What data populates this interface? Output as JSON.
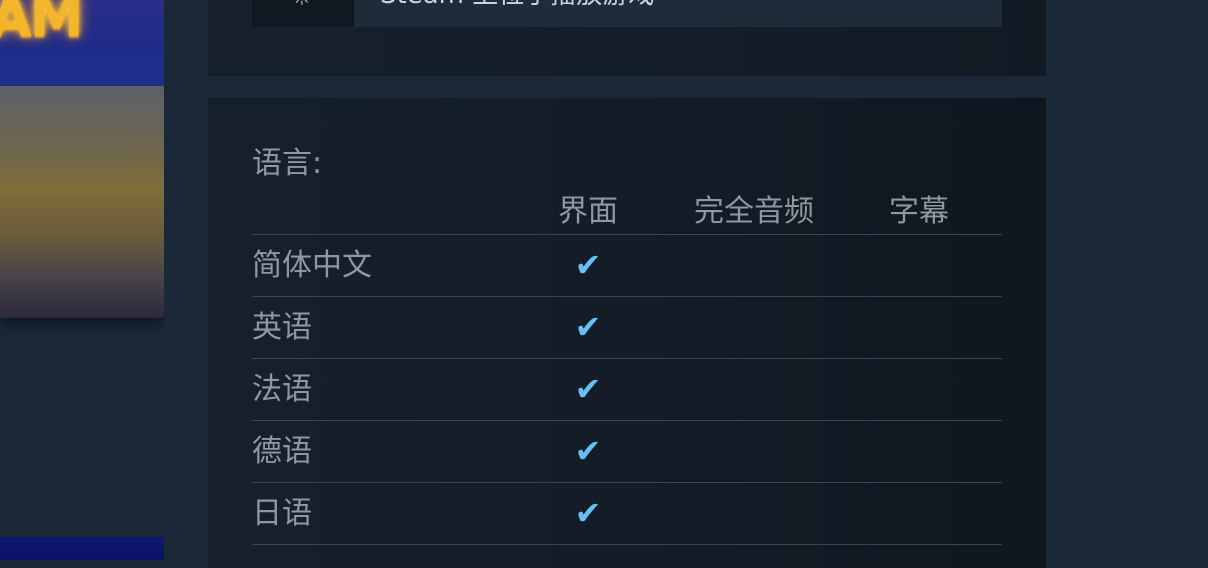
{
  "top_panel": {
    "icon": "☼",
    "text": "Steam 上位于播放游戏"
  },
  "promo": {
    "logo_text": "AM"
  },
  "languages": {
    "title": "语言:",
    "columns": [
      "界面",
      "完全音频",
      "字幕"
    ],
    "rows": [
      {
        "name": "简体中文",
        "interface": "✔",
        "audio": "",
        "subtitles": ""
      },
      {
        "name": "英语",
        "interface": "✔",
        "audio": "",
        "subtitles": ""
      },
      {
        "name": "法语",
        "interface": "✔",
        "audio": "",
        "subtitles": ""
      },
      {
        "name": "德语",
        "interface": "✔",
        "audio": "",
        "subtitles": ""
      },
      {
        "name": "日语",
        "interface": "✔",
        "audio": "",
        "subtitles": ""
      }
    ]
  },
  "colors": {
    "page_bg": "#1b2838",
    "panel_bg": "#16202d",
    "text_muted": "#8f98a0",
    "check_accent": "#66c0f4",
    "divider": "#3d4450"
  }
}
